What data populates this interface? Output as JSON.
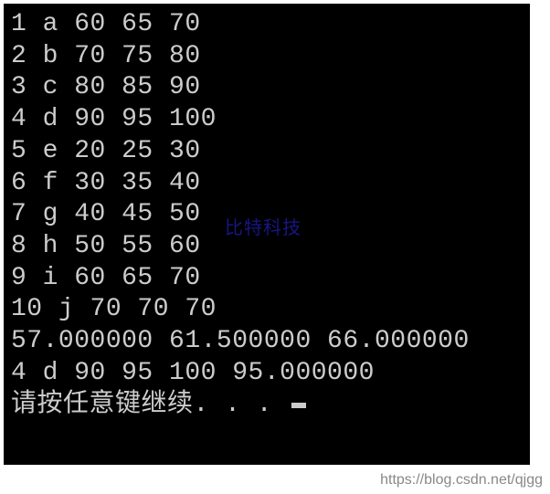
{
  "console": {
    "rows": [
      "1 a 60 65 70",
      "2 b 70 75 80",
      "3 c 80 85 90",
      "4 d 90 95 100",
      "5 e 20 25 30",
      "6 f 30 35 40",
      "7 g 40 45 50",
      "8 h 50 55 60",
      "9 i 60 65 70",
      "10 j 70 70 70",
      "57.000000 61.500000 66.000000",
      "4 d 90 95 100 95.000000"
    ],
    "prompt": "请按任意键继续. . . ",
    "watermark_cn": "比特科技",
    "url_watermark": "https://blog.csdn.net/qjgg"
  }
}
